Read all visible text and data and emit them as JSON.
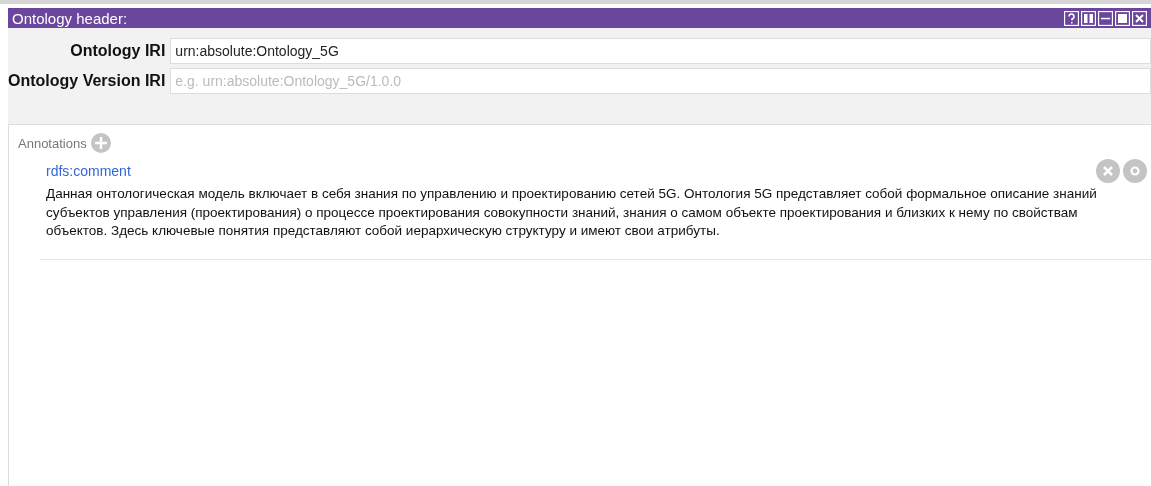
{
  "panel": {
    "title": "Ontology header:"
  },
  "fields": [
    {
      "label": "Ontology IRI",
      "value": "urn:absolute:Ontology_5G"
    },
    {
      "label": "Ontology Version IRI",
      "placeholder": "e.g. urn:absolute:Ontology_5G/1.0.0"
    }
  ],
  "annotations": {
    "label": "Annotations",
    "items": [
      {
        "property": "rdfs:comment",
        "text": "Данная онтологическая модель включает в себя знания по управлению и проектированию сетей 5G. Онтология 5G представляет собой формальное описание знаний субъектов управления (проектирования) о процессе проектирования совокупности знаний, знания о самом объекте проектирования и близких к нему по свойствам объектов. Здесь ключевые понятия представляют собой иерархическую структуру и имеют свои атрибуты."
      }
    ]
  }
}
